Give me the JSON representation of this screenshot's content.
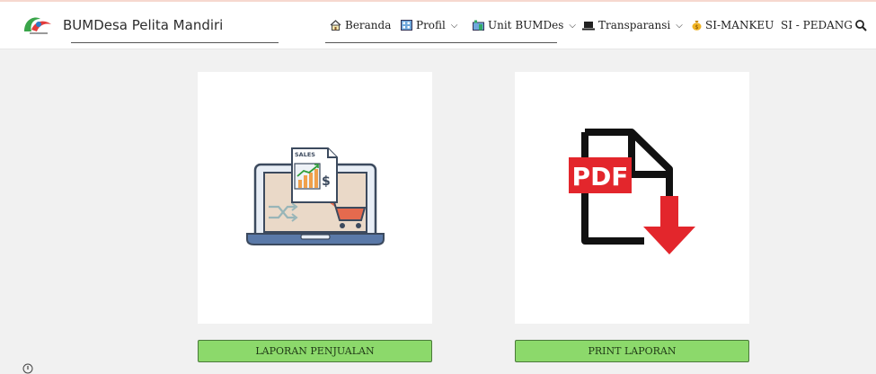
{
  "site": {
    "brand": "BUMDesa Pelita Mandiri"
  },
  "nav": {
    "home": "Beranda",
    "profile": "Profil",
    "unit": "Unit BUMDes",
    "transparency": "Transparansi",
    "simankeu": "SI-MANKEU",
    "sipedang": "SI - PEDANG"
  },
  "cards": {
    "sales_report": {
      "button": "LAPORAN PENJUALAN",
      "doc_label": "SALES",
      "currency": "$"
    },
    "print_report": {
      "button": "PRINT LAPORAN",
      "pdf_label": "PDF"
    }
  },
  "colors": {
    "button_green": "#8cd96b",
    "pdf_red": "#e3262c",
    "laptop_blue": "#5a79a8"
  },
  "icons": [
    "home-icon",
    "building-icon",
    "factory-icon",
    "laptop-icon",
    "money-bag-icon",
    "search-icon",
    "chevron-down-icon",
    "info-icon"
  ]
}
